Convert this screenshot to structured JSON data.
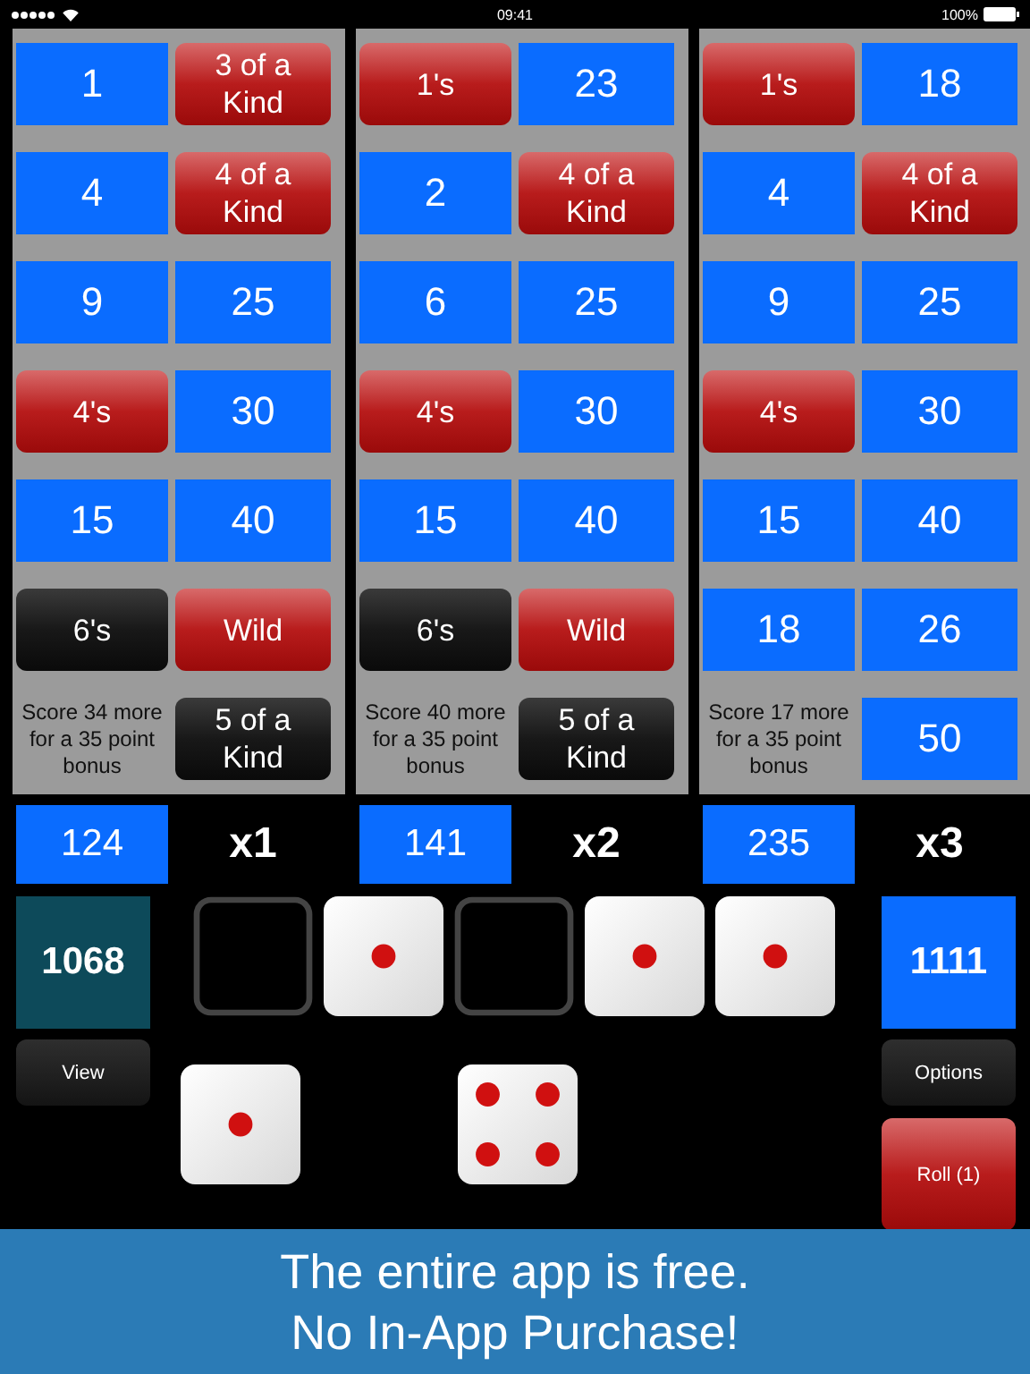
{
  "status_bar": {
    "time": "09:41",
    "battery": "100%"
  },
  "scorecards": [
    {
      "rows": [
        [
          {
            "kind": "score",
            "text": "1"
          },
          {
            "kind": "open",
            "text": "3 of a Kind"
          }
        ],
        [
          {
            "kind": "score",
            "text": "4"
          },
          {
            "kind": "open",
            "text": "4 of a Kind"
          }
        ],
        [
          {
            "kind": "score",
            "text": "9"
          },
          {
            "kind": "score",
            "text": "25"
          }
        ],
        [
          {
            "kind": "open",
            "text": "4's"
          },
          {
            "kind": "score",
            "text": "30"
          }
        ],
        [
          {
            "kind": "score",
            "text": "15"
          },
          {
            "kind": "score",
            "text": "40"
          }
        ],
        [
          {
            "kind": "closed",
            "text": "6's"
          },
          {
            "kind": "open",
            "text": "Wild"
          }
        ],
        [
          {
            "kind": "note",
            "text": "Score 34 more for a 35 point bonus"
          },
          {
            "kind": "closed",
            "text": "5 of a Kind"
          }
        ]
      ],
      "total": "124",
      "multiplier": "x1"
    },
    {
      "rows": [
        [
          {
            "kind": "open",
            "text": "1's"
          },
          {
            "kind": "score",
            "text": "23"
          }
        ],
        [
          {
            "kind": "score",
            "text": "2"
          },
          {
            "kind": "open",
            "text": "4 of a Kind"
          }
        ],
        [
          {
            "kind": "score",
            "text": "6"
          },
          {
            "kind": "score",
            "text": "25"
          }
        ],
        [
          {
            "kind": "open",
            "text": "4's"
          },
          {
            "kind": "score",
            "text": "30"
          }
        ],
        [
          {
            "kind": "score",
            "text": "15"
          },
          {
            "kind": "score",
            "text": "40"
          }
        ],
        [
          {
            "kind": "closed",
            "text": "6's"
          },
          {
            "kind": "open",
            "text": "Wild"
          }
        ],
        [
          {
            "kind": "note",
            "text": "Score 40 more for a 35 point bonus"
          },
          {
            "kind": "closed",
            "text": "5 of a Kind"
          }
        ]
      ],
      "total": "141",
      "multiplier": "x2"
    },
    {
      "rows": [
        [
          {
            "kind": "open",
            "text": "1's"
          },
          {
            "kind": "score",
            "text": "18"
          }
        ],
        [
          {
            "kind": "score",
            "text": "4"
          },
          {
            "kind": "open",
            "text": "4 of a Kind"
          }
        ],
        [
          {
            "kind": "score",
            "text": "9"
          },
          {
            "kind": "score",
            "text": "25"
          }
        ],
        [
          {
            "kind": "open",
            "text": "4's"
          },
          {
            "kind": "score",
            "text": "30"
          }
        ],
        [
          {
            "kind": "score",
            "text": "15"
          },
          {
            "kind": "score",
            "text": "40"
          }
        ],
        [
          {
            "kind": "score",
            "text": "18"
          },
          {
            "kind": "score",
            "text": "26"
          }
        ],
        [
          {
            "kind": "note",
            "text": "Score 17 more for a 35 point bonus"
          },
          {
            "kind": "score",
            "text": "50"
          }
        ]
      ],
      "total": "235",
      "multiplier": "x3"
    }
  ],
  "grand_total": "1068",
  "high_score": "1111",
  "held_dice": [
    {
      "kind": "empty"
    },
    {
      "kind": "one"
    },
    {
      "kind": "empty"
    },
    {
      "kind": "one"
    },
    {
      "kind": "one"
    }
  ],
  "rolled_dice": [
    {
      "kind": "one"
    },
    {
      "kind": "four"
    }
  ],
  "buttons": {
    "view": "View",
    "options": "Options",
    "roll": "Roll (1)"
  },
  "banner": [
    "The entire app is free.",
    "No In-App Purchase!"
  ]
}
